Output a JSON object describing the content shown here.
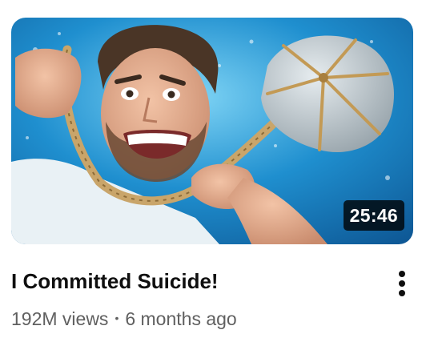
{
  "video": {
    "title": "I Committed Suicide!",
    "duration": "25:46",
    "views": "192M views",
    "separator": "•",
    "age": "6 months ago"
  },
  "icons": {
    "more": "more-vert-icon"
  }
}
